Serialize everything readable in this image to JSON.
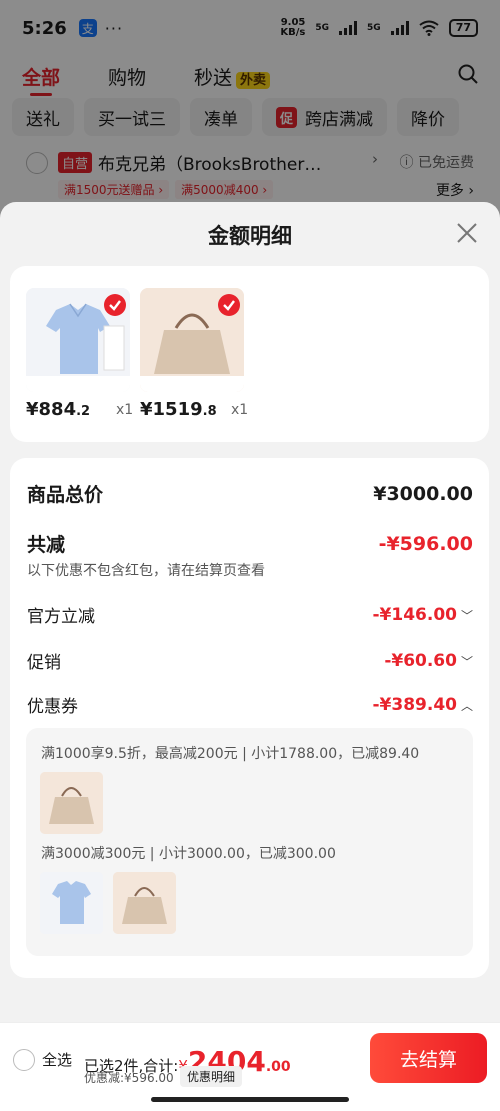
{
  "status_bar": {
    "time": "5:26",
    "alipay": "支",
    "dots": "···",
    "net_speed_top": "9.05",
    "net_speed_bottom": "KB/s",
    "net_5g_1": "5G",
    "net_5g_2": "5G",
    "battery": "77"
  },
  "top_tabs": [
    "全部",
    "购物",
    "秒送"
  ],
  "takeout_badge": "外卖",
  "chips": {
    "gift": "送礼",
    "trial": "买一试三",
    "combine": "凑单",
    "promo_mark": "促",
    "cross_store": "跨店满减",
    "price_drop": "降价"
  },
  "store": {
    "self_operated": "自营",
    "name": "布克兄弟（BrooksBrother…",
    "free_shipping": "已免运费",
    "promo_1": "满1500元送赠品 ›",
    "promo_2": "满5000减400 ›",
    "more": "更多 ›"
  },
  "sheet": {
    "title": "金额明细",
    "products": [
      {
        "price_main": "¥884",
        "price_dec": ".2",
        "qty": "x1"
      },
      {
        "price_main": "¥1519",
        "price_dec": ".8",
        "qty": "x1"
      }
    ],
    "total_label": "商品总价",
    "total_value": "¥3000.00",
    "reduce_label": "共减",
    "reduce_value": "-¥596.00",
    "note": "以下优惠不包含红包，请在结算页查看",
    "official_label": "官方立减",
    "official_value": "-¥146.00",
    "promo_label": "促销",
    "promo_value": "-¥60.60",
    "coupon_label": "优惠券",
    "coupon_value": "-¥389.40",
    "coupon_1": "满1000享9.5折，最高减200元 | 小计1788.00，已减89.40",
    "coupon_2": "满3000减300元 | 小计3000.00，已减300.00"
  },
  "bottom": {
    "select_all": "全选",
    "summary_prefix": "已选2件,合计:",
    "currency": "¥",
    "amount": "2404",
    "amount_dec": ".00",
    "saved": "优惠减:¥596.00",
    "detail": "优惠明细",
    "checkout": "去结算"
  },
  "colors": {
    "accent": "#e8232c",
    "takeout_yellow": "#ffd81a"
  }
}
